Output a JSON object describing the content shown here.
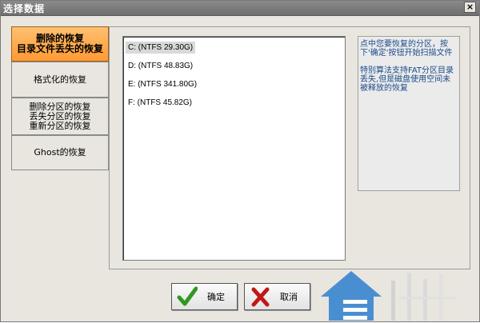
{
  "window": {
    "title": "选择数据",
    "close_label": "×"
  },
  "tabs": [
    {
      "lines": [
        "删除的恢复",
        "目录文件丢失的恢复"
      ],
      "active": true
    },
    {
      "lines": [
        "格式化的恢复"
      ],
      "active": false
    },
    {
      "lines": [
        "删除分区的恢复",
        "丢失分区的恢复",
        "重新分区的恢复"
      ],
      "active": false
    },
    {
      "lines": [
        "Ghost的恢复"
      ],
      "active": false
    }
  ],
  "drives": [
    {
      "label": "C:  (NTFS 29.30G)",
      "selected": true
    },
    {
      "label": "D:  (NTFS 48.83G)",
      "selected": false
    },
    {
      "label": "E:  (NTFS 341.80G)",
      "selected": false
    },
    {
      "label": "F:  (NTFS 45.82G)",
      "selected": false
    }
  ],
  "help": {
    "line1": "点中您要恢复的分区，按下'确定'按钮开始扫描文件",
    "line2": "特别算法支持FAT分区目录丢失,但是磁盘使用空间未被释放的恢复"
  },
  "buttons": {
    "ok_label": "确定",
    "cancel_label": "取消"
  },
  "colors": {
    "active_tab": "#ff9a33",
    "help_text": "#1a4a8a",
    "ok_icon": "#2e9a1e",
    "cancel_icon": "#c01818"
  }
}
